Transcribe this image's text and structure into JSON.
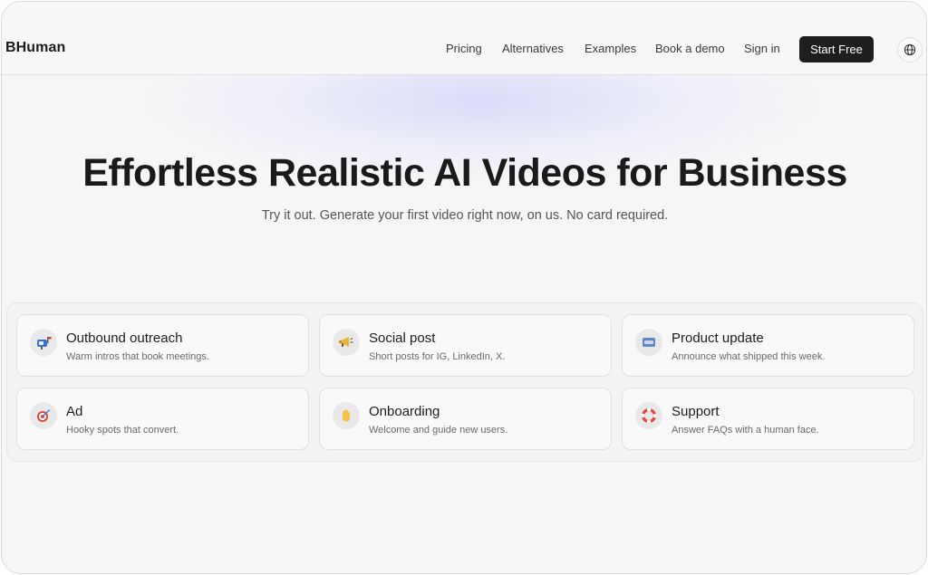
{
  "nav": {
    "logo": "BHuman",
    "links": [
      "Pricing",
      "Alternatives",
      "Examples",
      "Book a demo",
      "Sign in"
    ],
    "cta": "Start Free",
    "globe_icon": "globe-icon"
  },
  "hero": {
    "title": "Effortless Realistic AI Videos for Business",
    "subtitle": "Try it out. Generate your first video right now, on us. No card required."
  },
  "use_cases": [
    {
      "title": "Outbound outreach",
      "desc": "Warm intros that book meetings.",
      "icon": "mailbox-icon"
    },
    {
      "title": "Social post",
      "desc": "Short posts for IG, LinkedIn, X.",
      "icon": "megaphone-icon"
    },
    {
      "title": "Product update",
      "desc": "Announce what shipped this week.",
      "icon": "new-badge-icon"
    },
    {
      "title": "Ad",
      "desc": "Hooky spots that convert.",
      "icon": "target-icon"
    },
    {
      "title": "Onboarding",
      "desc": "Welcome and guide new users.",
      "icon": "waving-hand-icon"
    },
    {
      "title": "Support",
      "desc": "Answer FAQs with a human face.",
      "icon": "lifebuoy-icon"
    }
  ],
  "colors": {
    "background": "#f6f6f6",
    "cta_bg": "#1e1e1e",
    "glow": "#d0d2fa"
  }
}
